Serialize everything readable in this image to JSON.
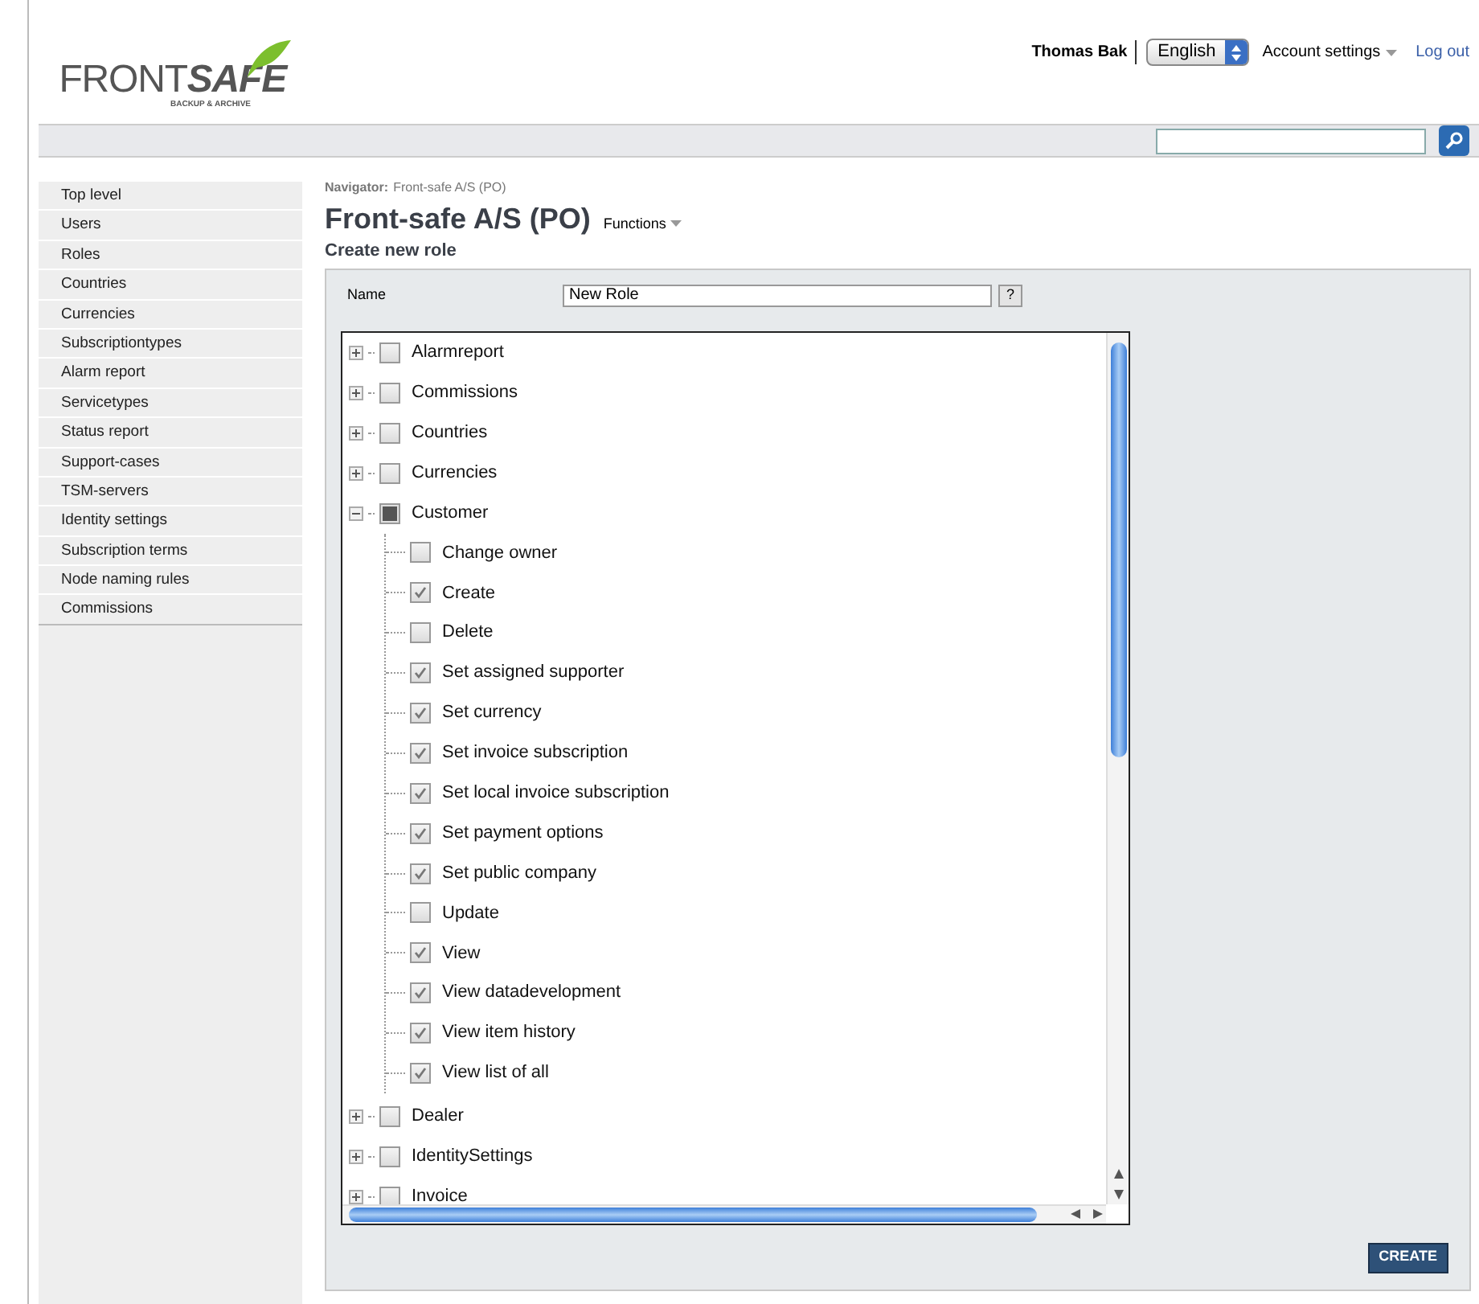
{
  "header": {
    "logo": {
      "word_light": "FRONT",
      "word_bold": "SAFE",
      "tagline": "BACKUP & ARCHIVE"
    },
    "user": "Thomas Bak",
    "language": "English",
    "account_settings": "Account settings",
    "logout": "Log out"
  },
  "sidebar": {
    "items": [
      {
        "label": "Top level"
      },
      {
        "label": "Users"
      },
      {
        "label": "Roles"
      },
      {
        "label": "Countries"
      },
      {
        "label": "Currencies"
      },
      {
        "label": "Subscriptiontypes"
      },
      {
        "label": "Alarm report"
      },
      {
        "label": "Servicetypes"
      },
      {
        "label": "Status report"
      },
      {
        "label": "Support-cases"
      },
      {
        "label": "TSM-servers"
      },
      {
        "label": "Identity settings"
      },
      {
        "label": "Subscription terms"
      },
      {
        "label": "Node naming rules"
      },
      {
        "label": "Commissions"
      }
    ]
  },
  "navigator": {
    "label": "Navigator:",
    "path": "Front-safe A/S (PO)"
  },
  "title": "Front-safe A/S (PO)",
  "functions": "Functions",
  "subtitle": "Create new role",
  "form": {
    "name_label": "Name",
    "name_value": "New Role",
    "help": "?"
  },
  "tree": [
    {
      "label": "Alarmreport",
      "checked": false,
      "partial": false,
      "expanded": false
    },
    {
      "label": "Commissions",
      "checked": false,
      "partial": false,
      "expanded": false
    },
    {
      "label": "Countries",
      "checked": false,
      "partial": false,
      "expanded": false
    },
    {
      "label": "Currencies",
      "checked": false,
      "partial": false,
      "expanded": false
    },
    {
      "label": "Customer",
      "checked": false,
      "partial": true,
      "expanded": true,
      "children": [
        {
          "label": "Change owner",
          "checked": false
        },
        {
          "label": "Create",
          "checked": true
        },
        {
          "label": "Delete",
          "checked": false
        },
        {
          "label": "Set assigned supporter",
          "checked": true
        },
        {
          "label": "Set currency",
          "checked": true
        },
        {
          "label": "Set invoice subscription",
          "checked": true
        },
        {
          "label": "Set local invoice subscription",
          "checked": true
        },
        {
          "label": "Set payment options",
          "checked": true
        },
        {
          "label": "Set public company",
          "checked": true
        },
        {
          "label": "Update",
          "checked": false
        },
        {
          "label": "View",
          "checked": true
        },
        {
          "label": "View datadevelopment",
          "checked": true
        },
        {
          "label": "View item history",
          "checked": true
        },
        {
          "label": "View list of all",
          "checked": true
        }
      ]
    },
    {
      "label": "Dealer",
      "checked": false,
      "partial": false,
      "expanded": false
    },
    {
      "label": "IdentitySettings",
      "checked": false,
      "partial": false,
      "expanded": false
    },
    {
      "label": "Invoice",
      "checked": false,
      "partial": false,
      "expanded": false
    }
  ],
  "create_button": "CREATE"
}
